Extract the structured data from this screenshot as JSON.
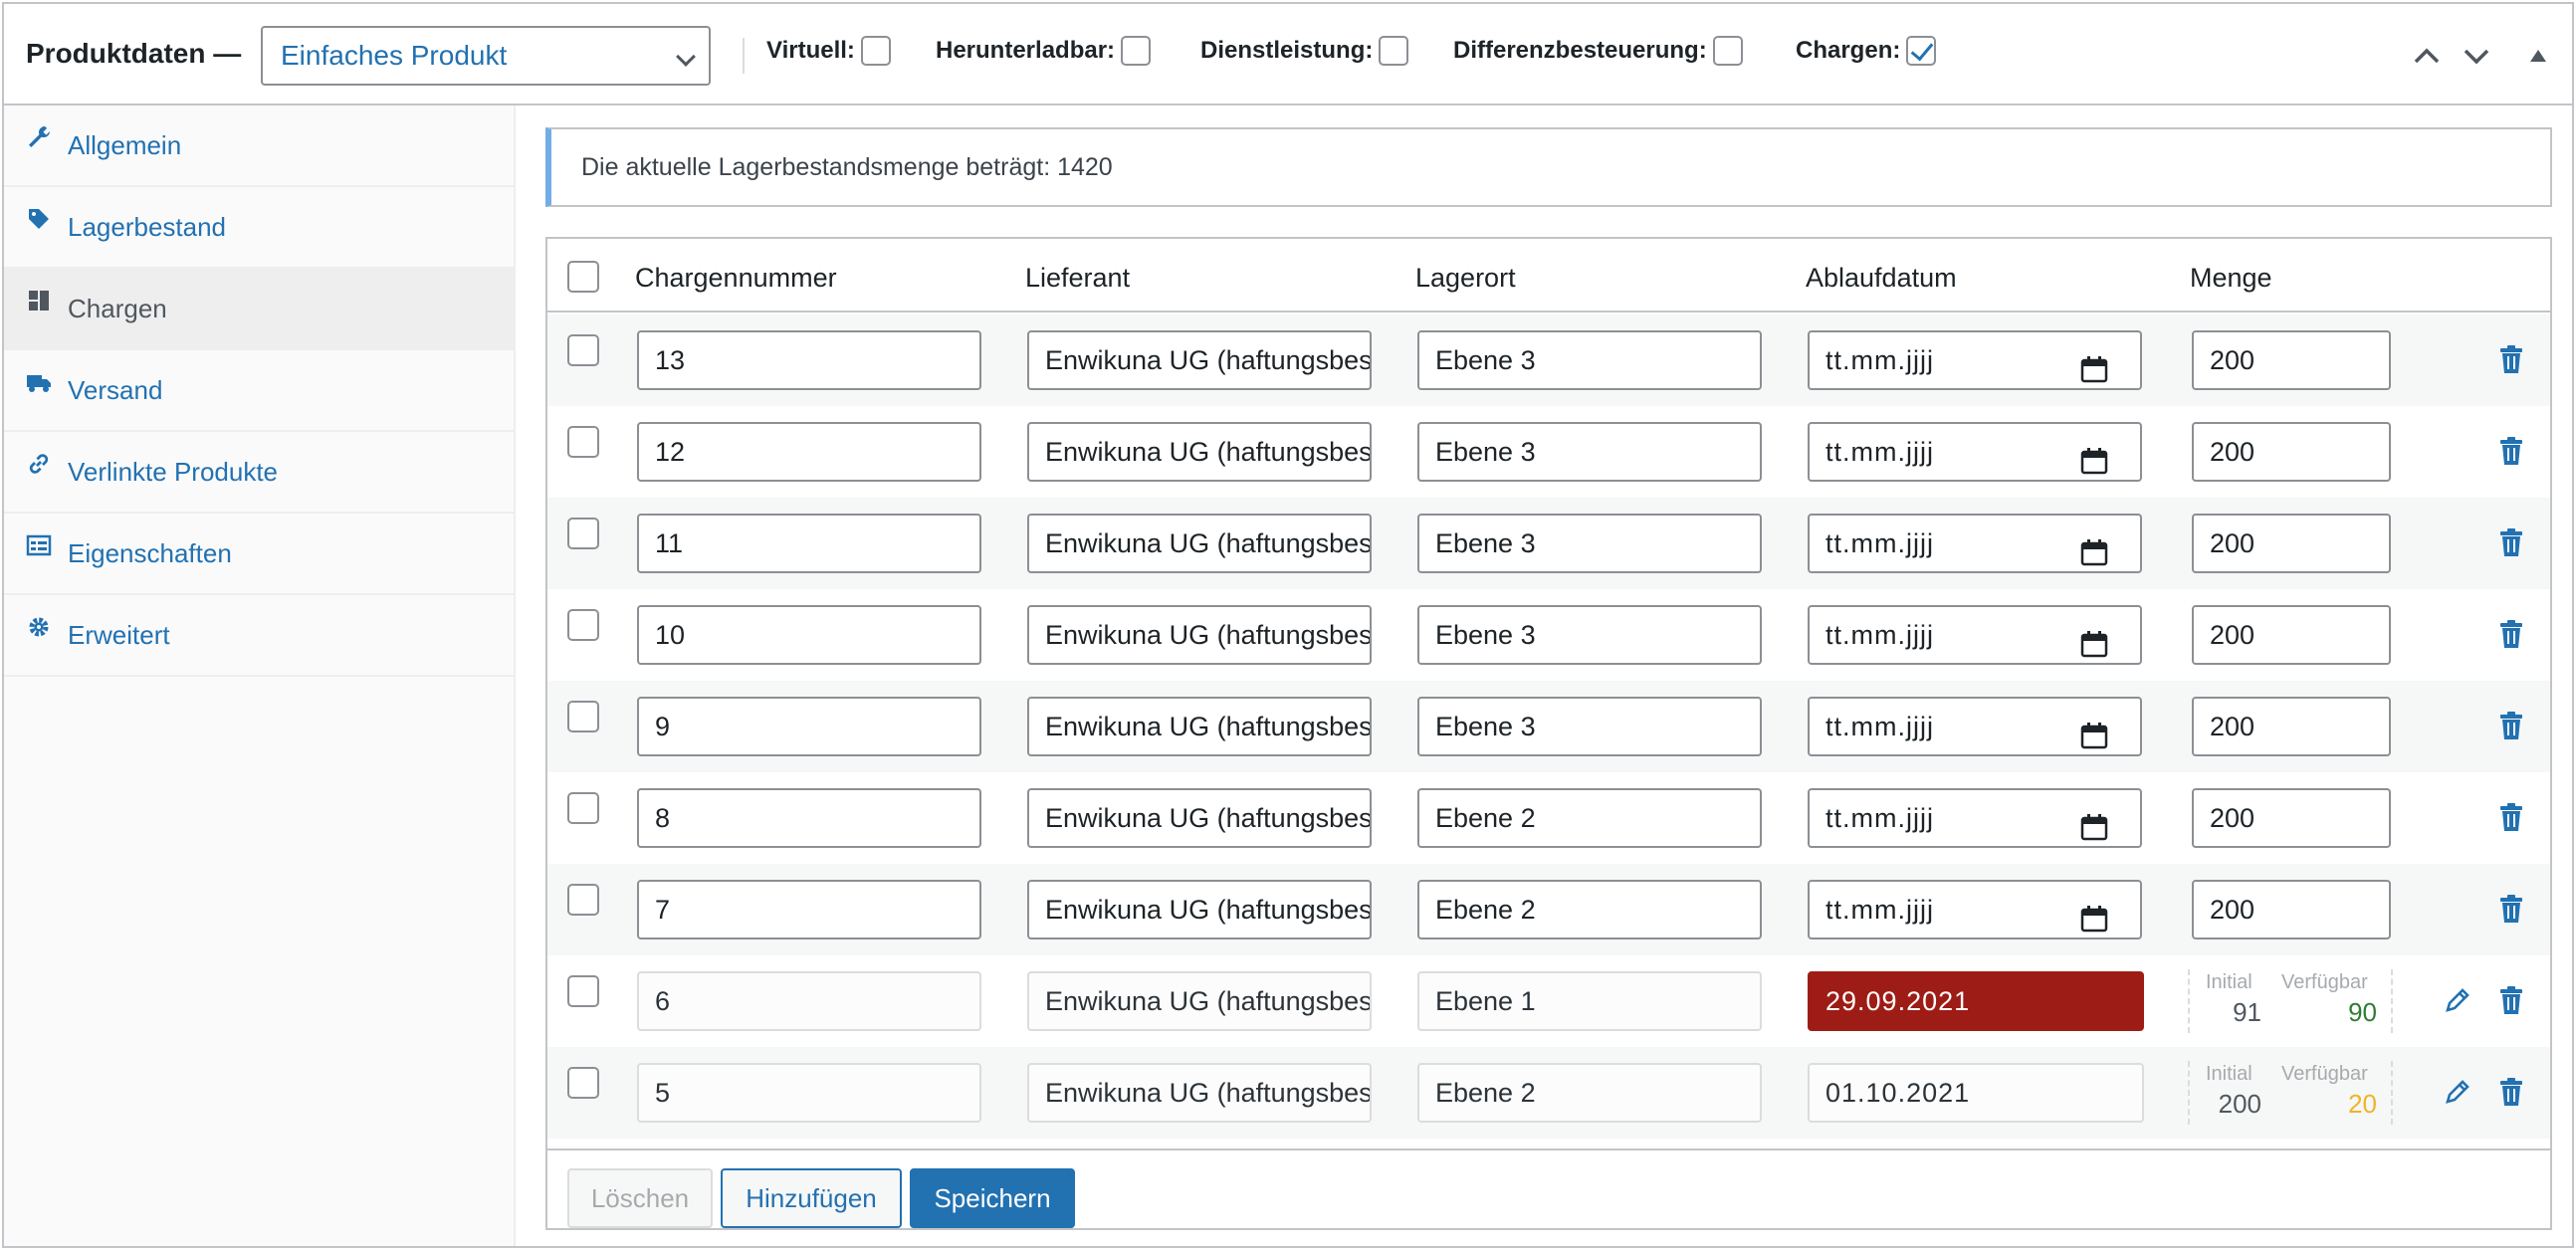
{
  "header": {
    "title": "Produktdaten —",
    "product_type": "Einfaches Produkt",
    "options": [
      {
        "label": "Virtuell:",
        "checked": false
      },
      {
        "label": "Herunterladbar:",
        "checked": false
      },
      {
        "label": "Dienstleistung:",
        "checked": false
      },
      {
        "label": "Differenzbesteuerung:",
        "checked": false
      },
      {
        "label": "Chargen:",
        "checked": true
      }
    ]
  },
  "sidebar": {
    "items": [
      {
        "label": "Allgemein",
        "icon": "wrench-icon"
      },
      {
        "label": "Lagerbestand",
        "icon": "tag-icon"
      },
      {
        "label": "Chargen",
        "icon": "batches-icon",
        "active": true
      },
      {
        "label": "Versand",
        "icon": "truck-icon"
      },
      {
        "label": "Verlinkte Produkte",
        "icon": "link-icon"
      },
      {
        "label": "Eigenschaften",
        "icon": "list-icon"
      },
      {
        "label": "Erweitert",
        "icon": "gear-icon"
      }
    ]
  },
  "notice": "Die aktuelle Lagerbestandsmenge beträgt: 1420",
  "table": {
    "headers": [
      "Chargennummer",
      "Lieferant",
      "Lagerort",
      "Ablaufdatum",
      "Menge"
    ],
    "rows": [
      {
        "batch": "13",
        "supplier": "Enwikuna UG (haftungsbeschränkt)",
        "location": "Ebene 3",
        "date": "tt.mm.jjjj",
        "qty": "200"
      },
      {
        "batch": "12",
        "supplier": "Enwikuna UG (haftungsbeschränkt)",
        "location": "Ebene 3",
        "date": "tt.mm.jjjj",
        "qty": "200"
      },
      {
        "batch": "11",
        "supplier": "Enwikuna UG (haftungsbeschränkt)",
        "location": "Ebene 3",
        "date": "tt.mm.jjjj",
        "qty": "200"
      },
      {
        "batch": "10",
        "supplier": "Enwikuna UG (haftungsbeschränkt)",
        "location": "Ebene 3",
        "date": "tt.mm.jjjj",
        "qty": "200"
      },
      {
        "batch": "9",
        "supplier": "Enwikuna UG (haftungsbeschränkt)",
        "location": "Ebene 3",
        "date": "tt.mm.jjjj",
        "qty": "200"
      },
      {
        "batch": "8",
        "supplier": "Enwikuna UG (haftungsbeschränkt)",
        "location": "Ebene 2",
        "date": "tt.mm.jjjj",
        "qty": "200"
      },
      {
        "batch": "7",
        "supplier": "Enwikuna UG (haftungsbeschränkt)",
        "location": "Ebene 2",
        "date": "tt.mm.jjjj",
        "qty": "200"
      }
    ],
    "saved_rows": [
      {
        "batch": "6",
        "supplier": "Enwikuna UG (haftungsbeschränkt)",
        "location": "Ebene 1",
        "date": "29.09.2021",
        "expired": true,
        "initial_label": "Initial",
        "initial": "91",
        "available_label": "Verfügbar",
        "available": "90",
        "available_color": "#2e7d32"
      },
      {
        "batch": "5",
        "supplier": "Enwikuna UG (haftungsbeschränkt)",
        "location": "Ebene 2",
        "date": "01.10.2021",
        "expired": false,
        "initial_label": "Initial",
        "initial": "200",
        "available_label": "Verfügbar",
        "available": "20",
        "available_color": "#f0b428"
      }
    ]
  },
  "buttons": {
    "delete": "Löschen",
    "add": "Hinzufügen",
    "save": "Speichern"
  },
  "colors": {
    "link": "#2271b1",
    "expired": "#9e1c16"
  }
}
